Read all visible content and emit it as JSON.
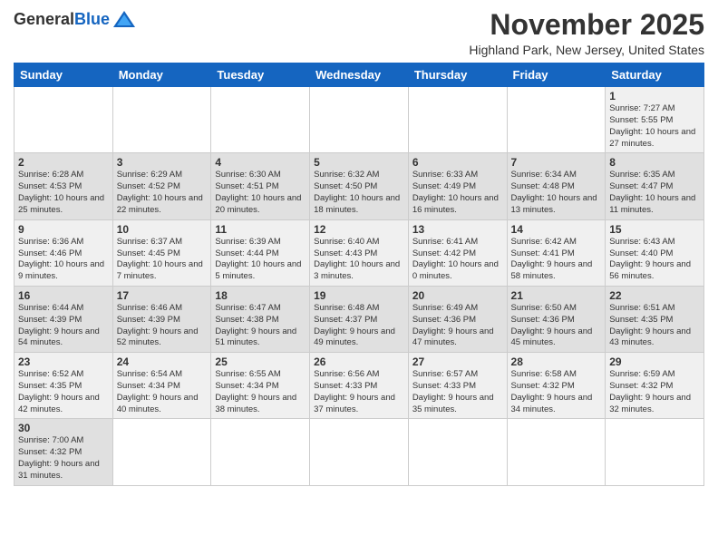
{
  "header": {
    "logo_general": "General",
    "logo_blue": "Blue",
    "title": "November 2025",
    "location": "Highland Park, New Jersey, United States"
  },
  "weekdays": [
    "Sunday",
    "Monday",
    "Tuesday",
    "Wednesday",
    "Thursday",
    "Friday",
    "Saturday"
  ],
  "weeks": [
    [
      {
        "day": "",
        "info": ""
      },
      {
        "day": "",
        "info": ""
      },
      {
        "day": "",
        "info": ""
      },
      {
        "day": "",
        "info": ""
      },
      {
        "day": "",
        "info": ""
      },
      {
        "day": "",
        "info": ""
      },
      {
        "day": "1",
        "info": "Sunrise: 7:27 AM\nSunset: 5:55 PM\nDaylight: 10 hours and 27 minutes."
      }
    ],
    [
      {
        "day": "2",
        "info": "Sunrise: 6:28 AM\nSunset: 4:53 PM\nDaylight: 10 hours and 25 minutes."
      },
      {
        "day": "3",
        "info": "Sunrise: 6:29 AM\nSunset: 4:52 PM\nDaylight: 10 hours and 22 minutes."
      },
      {
        "day": "4",
        "info": "Sunrise: 6:30 AM\nSunset: 4:51 PM\nDaylight: 10 hours and 20 minutes."
      },
      {
        "day": "5",
        "info": "Sunrise: 6:32 AM\nSunset: 4:50 PM\nDaylight: 10 hours and 18 minutes."
      },
      {
        "day": "6",
        "info": "Sunrise: 6:33 AM\nSunset: 4:49 PM\nDaylight: 10 hours and 16 minutes."
      },
      {
        "day": "7",
        "info": "Sunrise: 6:34 AM\nSunset: 4:48 PM\nDaylight: 10 hours and 13 minutes."
      },
      {
        "day": "8",
        "info": "Sunrise: 6:35 AM\nSunset: 4:47 PM\nDaylight: 10 hours and 11 minutes."
      }
    ],
    [
      {
        "day": "9",
        "info": "Sunrise: 6:36 AM\nSunset: 4:46 PM\nDaylight: 10 hours and 9 minutes."
      },
      {
        "day": "10",
        "info": "Sunrise: 6:37 AM\nSunset: 4:45 PM\nDaylight: 10 hours and 7 minutes."
      },
      {
        "day": "11",
        "info": "Sunrise: 6:39 AM\nSunset: 4:44 PM\nDaylight: 10 hours and 5 minutes."
      },
      {
        "day": "12",
        "info": "Sunrise: 6:40 AM\nSunset: 4:43 PM\nDaylight: 10 hours and 3 minutes."
      },
      {
        "day": "13",
        "info": "Sunrise: 6:41 AM\nSunset: 4:42 PM\nDaylight: 10 hours and 0 minutes."
      },
      {
        "day": "14",
        "info": "Sunrise: 6:42 AM\nSunset: 4:41 PM\nDaylight: 9 hours and 58 minutes."
      },
      {
        "day": "15",
        "info": "Sunrise: 6:43 AM\nSunset: 4:40 PM\nDaylight: 9 hours and 56 minutes."
      }
    ],
    [
      {
        "day": "16",
        "info": "Sunrise: 6:44 AM\nSunset: 4:39 PM\nDaylight: 9 hours and 54 minutes."
      },
      {
        "day": "17",
        "info": "Sunrise: 6:46 AM\nSunset: 4:39 PM\nDaylight: 9 hours and 52 minutes."
      },
      {
        "day": "18",
        "info": "Sunrise: 6:47 AM\nSunset: 4:38 PM\nDaylight: 9 hours and 51 minutes."
      },
      {
        "day": "19",
        "info": "Sunrise: 6:48 AM\nSunset: 4:37 PM\nDaylight: 9 hours and 49 minutes."
      },
      {
        "day": "20",
        "info": "Sunrise: 6:49 AM\nSunset: 4:36 PM\nDaylight: 9 hours and 47 minutes."
      },
      {
        "day": "21",
        "info": "Sunrise: 6:50 AM\nSunset: 4:36 PM\nDaylight: 9 hours and 45 minutes."
      },
      {
        "day": "22",
        "info": "Sunrise: 6:51 AM\nSunset: 4:35 PM\nDaylight: 9 hours and 43 minutes."
      }
    ],
    [
      {
        "day": "23",
        "info": "Sunrise: 6:52 AM\nSunset: 4:35 PM\nDaylight: 9 hours and 42 minutes."
      },
      {
        "day": "24",
        "info": "Sunrise: 6:54 AM\nSunset: 4:34 PM\nDaylight: 9 hours and 40 minutes."
      },
      {
        "day": "25",
        "info": "Sunrise: 6:55 AM\nSunset: 4:34 PM\nDaylight: 9 hours and 38 minutes."
      },
      {
        "day": "26",
        "info": "Sunrise: 6:56 AM\nSunset: 4:33 PM\nDaylight: 9 hours and 37 minutes."
      },
      {
        "day": "27",
        "info": "Sunrise: 6:57 AM\nSunset: 4:33 PM\nDaylight: 9 hours and 35 minutes."
      },
      {
        "day": "28",
        "info": "Sunrise: 6:58 AM\nSunset: 4:32 PM\nDaylight: 9 hours and 34 minutes."
      },
      {
        "day": "29",
        "info": "Sunrise: 6:59 AM\nSunset: 4:32 PM\nDaylight: 9 hours and 32 minutes."
      }
    ],
    [
      {
        "day": "30",
        "info": "Sunrise: 7:00 AM\nSunset: 4:32 PM\nDaylight: 9 hours and 31 minutes."
      },
      {
        "day": "",
        "info": ""
      },
      {
        "day": "",
        "info": ""
      },
      {
        "day": "",
        "info": ""
      },
      {
        "day": "",
        "info": ""
      },
      {
        "day": "",
        "info": ""
      },
      {
        "day": "",
        "info": ""
      }
    ]
  ]
}
